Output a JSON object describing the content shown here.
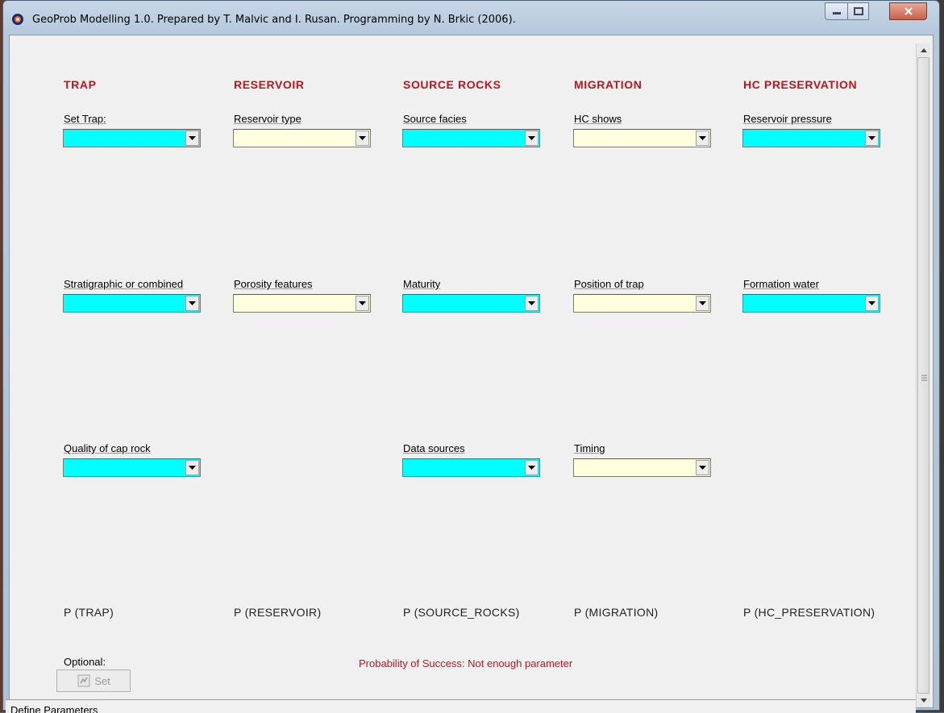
{
  "window": {
    "title": "GeoProb Modelling 1.0.   Prepared by T. Malvic and I. Rusan. Programming by N. Brkic (2006)."
  },
  "colors": {
    "header_red": "#c0141c",
    "combo_cyan": "#00ffff",
    "combo_yellow": "#ffffe0"
  },
  "columns": [
    {
      "header": "TRAP",
      "fields": [
        "Set Trap:",
        "Stratigraphic or combined",
        "Quality of cap rock"
      ],
      "probability": "P (TRAP)"
    },
    {
      "header": "RESERVOIR",
      "fields": [
        "Reservoir type",
        "Porosity features"
      ],
      "probability": "P (RESERVOIR)"
    },
    {
      "header": "SOURCE ROCKS",
      "fields": [
        "Source facies",
        "Maturity",
        "Data sources"
      ],
      "probability": "P (SOURCE_ROCKS)"
    },
    {
      "header": "MIGRATION",
      "fields": [
        "HC shows",
        "Position of trap",
        "Timing"
      ],
      "probability": "P (MIGRATION)"
    },
    {
      "header": "HC PRESERVATION",
      "fields": [
        "Reservoir pressure",
        "Formation water"
      ],
      "probability": "P (HC_PRESERVATION)"
    }
  ],
  "optional": {
    "label": "Optional:",
    "set_button": "Set"
  },
  "result_text": "Probability of Success: Not enough parameter",
  "status_bar": "Define Parameters"
}
